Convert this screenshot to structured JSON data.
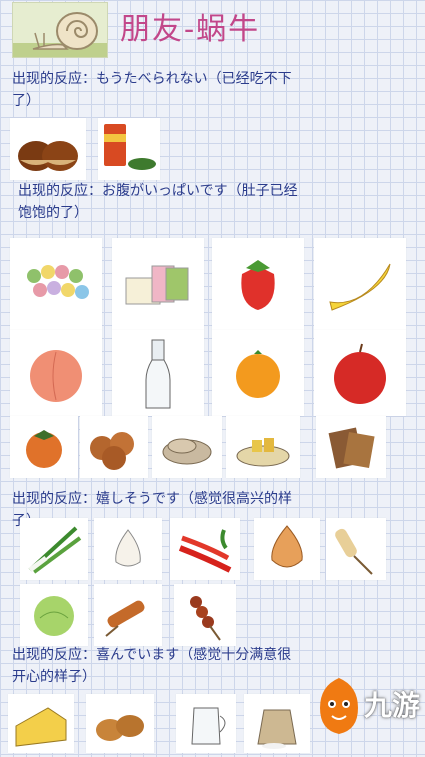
{
  "header": {
    "title": "朋友-蜗牛"
  },
  "sections": [
    {
      "line1": "出现的反应：もうたべられない（已经吃不下",
      "line2": "了）"
    },
    {
      "line1": "出现的反应：お腹がいっぱいです（肚子已经",
      "line2": "饱饱的了）"
    },
    {
      "line1": "出现的反应：嬉しそうです（感觉很高兴的样",
      "line2": "子）"
    },
    {
      "line1": "出现的反应：喜んでいます（感觉十分满意很",
      "line2": "开心的样子）"
    }
  ],
  "items": {
    "s1": [
      "chestnuts",
      "canned-food"
    ],
    "s2": [
      "dango",
      "rice-cake",
      "strawberry",
      "banana",
      "peach",
      "milk-bottle",
      "orange",
      "apple",
      "persimmon",
      "cookies",
      "crackers",
      "snacks",
      "biscuits"
    ],
    "s3": [
      "green-onion",
      "garlic",
      "chili-pepper",
      "onion",
      "skewer",
      "cabbage",
      "grilled-skewer",
      "meat-skewer"
    ],
    "s4": [
      "cheese",
      "bread-buns",
      "milk-jug",
      "flour-sack"
    ]
  },
  "brand": {
    "name": "九游",
    "color": "#f07a12"
  }
}
